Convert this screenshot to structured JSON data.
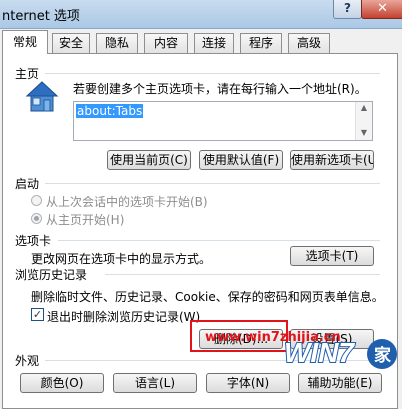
{
  "window": {
    "title": "nternet 选项",
    "help_label": "?",
    "close_label": "✕"
  },
  "tabs": [
    "常规",
    "安全",
    "隐私",
    "内容",
    "连接",
    "程序",
    "高级"
  ],
  "home": {
    "section_title": "主页",
    "instruction": "若要创建多个主页选项卡，请在每行输入一个地址(R)。",
    "value": "about:Tabs",
    "buttons": [
      "使用当前页(C)",
      "使用默认值(F)",
      "使用新选项卡(U)"
    ]
  },
  "startup": {
    "section_title": "启动",
    "options": [
      {
        "label": "从上次会话中的选项卡开始(B)",
        "checked": false
      },
      {
        "label": "从主页开始(H)",
        "checked": true
      }
    ]
  },
  "tabs_section": {
    "section_title": "选项卡",
    "description": "更改网页在选项卡中的显示方式。",
    "button": "选项卡(T)"
  },
  "history": {
    "section_title": "浏览历史记录",
    "description": "删除临时文件、历史记录、Cookie、保存的密码和网页表单信息。",
    "checkbox_label": "退出时删除浏览历史记录(W)",
    "checkbox_checked": true,
    "delete_button": "删除(D)...",
    "settings_button": "设置(S)"
  },
  "appearance": {
    "section_title": "外观",
    "buttons": [
      "颜色(O)",
      "语言(L)",
      "字体(N)",
      "辅助功能(E)"
    ]
  },
  "watermark": {
    "text": "www.win7zhijia.cn",
    "logo_text": "WIN7",
    "logo_suffix": "家"
  },
  "colors": {
    "accent_red": "#e0141a",
    "selection_blue": "#3399ff",
    "close_red": "#c4412f"
  }
}
